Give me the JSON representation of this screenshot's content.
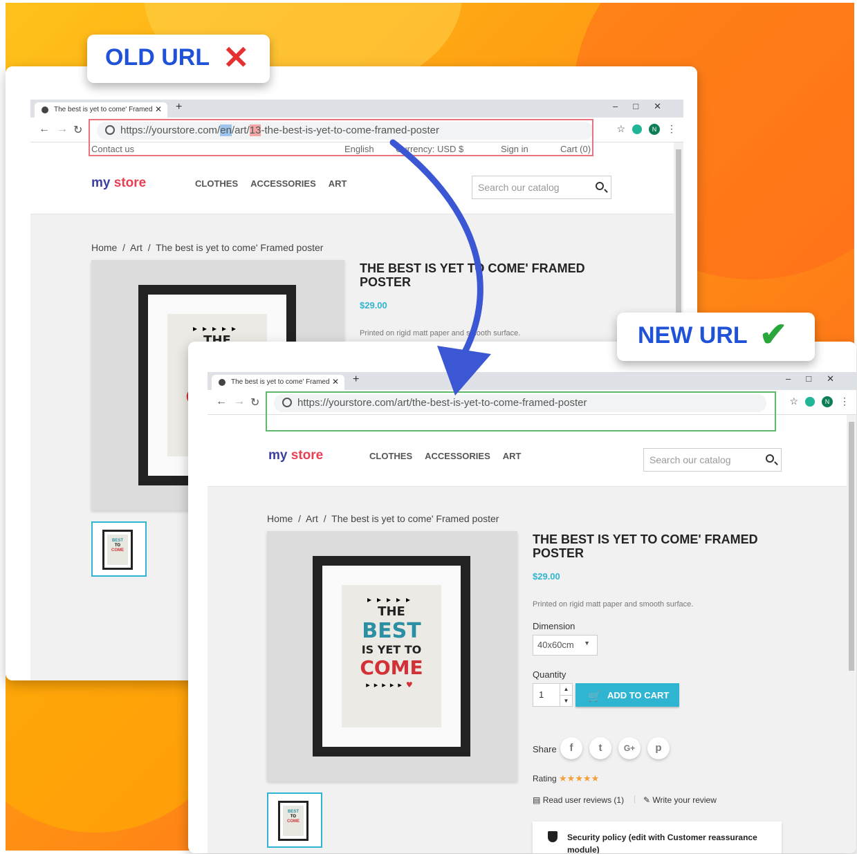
{
  "colors": {
    "accent": "#2fb5d2",
    "old_frame": "#e8737f",
    "new_frame": "#5db86a",
    "callout_text": "#1f52d6",
    "arrow": "#3b57d4"
  },
  "old": {
    "callout_label": "OLD URL",
    "tab_title": "The best is yet to come' Framed",
    "url_prefix": "https://yourstore.com/",
    "url_lang": "en",
    "url_mid": "/art/",
    "url_id": "13",
    "url_suffix": "-the-best-is-yet-to-come-framed-poster",
    "topnav": {
      "contact": "Contact us",
      "language": "English",
      "currency": "Currency: USD $",
      "signin": "Sign in",
      "cart": "Cart (0)"
    }
  },
  "new": {
    "callout_label": "NEW URL",
    "tab_title": "The best is yet to come' Framed",
    "url": "https://yourstore.com/art/the-best-is-yet-to-come-framed-poster"
  },
  "store": {
    "logo_my": "my",
    "logo_store": "store",
    "menu": [
      "CLOTHES",
      "ACCESSORIES",
      "ART"
    ],
    "search_placeholder": "Search our catalog",
    "breadcrumb": [
      "Home",
      "Art",
      "The best is yet to come' Framed poster"
    ]
  },
  "product": {
    "title": "THE BEST IS YET TO COME' FRAMED POSTER",
    "price": "$29.00",
    "description": "Printed on rigid matt paper and smooth surface.",
    "dimension_label": "Dimension",
    "dimension_value": "40x60cm",
    "quantity_label": "Quantity",
    "quantity_value": "1",
    "add_to_cart": "ADD TO CART",
    "share_label": "Share",
    "rating_label": "Rating",
    "rating_stars": 5,
    "read_reviews": "Read user reviews (1)",
    "write_review": "Write your review",
    "security": "Security policy (edit with Customer reassurance module)"
  },
  "poster_text": {
    "line1": "THE",
    "line2": "BEST",
    "line3a": "IS YET",
    "line3b": "TO",
    "line4": "COME"
  }
}
